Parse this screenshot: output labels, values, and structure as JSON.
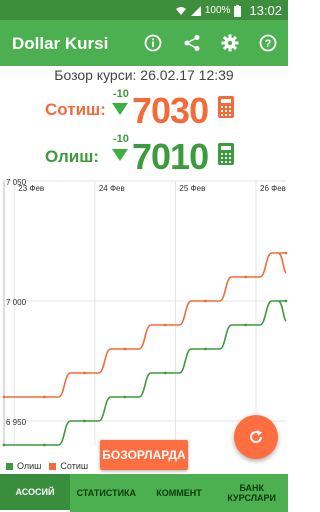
{
  "status_bar": {
    "battery_percent": "100%",
    "time": "13:02"
  },
  "app_bar": {
    "title": "Dollar Kursi",
    "icons": [
      "info-icon",
      "share-icon",
      "gear-icon",
      "help-icon"
    ]
  },
  "subtitle": "Бозор курси: 26.02.17 12:39",
  "rates": {
    "sell": {
      "label": "Сотиш:",
      "delta": "-10",
      "value": "7030",
      "color": "#f26b3a"
    },
    "buy": {
      "label": "Олиш:",
      "delta": "-10",
      "value": "7010",
      "color": "#3c9b3c"
    }
  },
  "chart_data": {
    "type": "line",
    "x_ticks": [
      "23 Фев",
      "24 Фев",
      "25 Фев",
      "26 Фев"
    ],
    "y_ticks": [
      "7 050",
      "7 000",
      "6 950"
    ],
    "ylim": [
      6940,
      7050
    ],
    "series": [
      {
        "name": "Олиш",
        "color": "#3c9b3c",
        "x": [
          0,
          0.5,
          1,
          1.5,
          2,
          2.5,
          3,
          3.5
        ],
        "y": [
          6940,
          6940,
          6950,
          6960,
          6970,
          6980,
          6990,
          7000
        ]
      },
      {
        "name": "Сотиш",
        "color": "#f26b3a",
        "x": [
          0,
          0.5,
          1,
          1.5,
          2,
          2.5,
          3,
          3.5
        ],
        "y": [
          6960,
          6960,
          6970,
          6980,
          6990,
          7000,
          7010,
          7020
        ]
      }
    ],
    "legend_position": "bottom-left"
  },
  "bozor_button": "БОЗОРЛАРДА",
  "bottom_nav": [
    {
      "label": "АСОСИЙ",
      "active": true
    },
    {
      "label": "СТАТИСТИКА",
      "active": false
    },
    {
      "label": "КОММЕНТ",
      "active": false
    },
    {
      "label": "БАНК КУРСЛАРИ",
      "active": false
    }
  ]
}
